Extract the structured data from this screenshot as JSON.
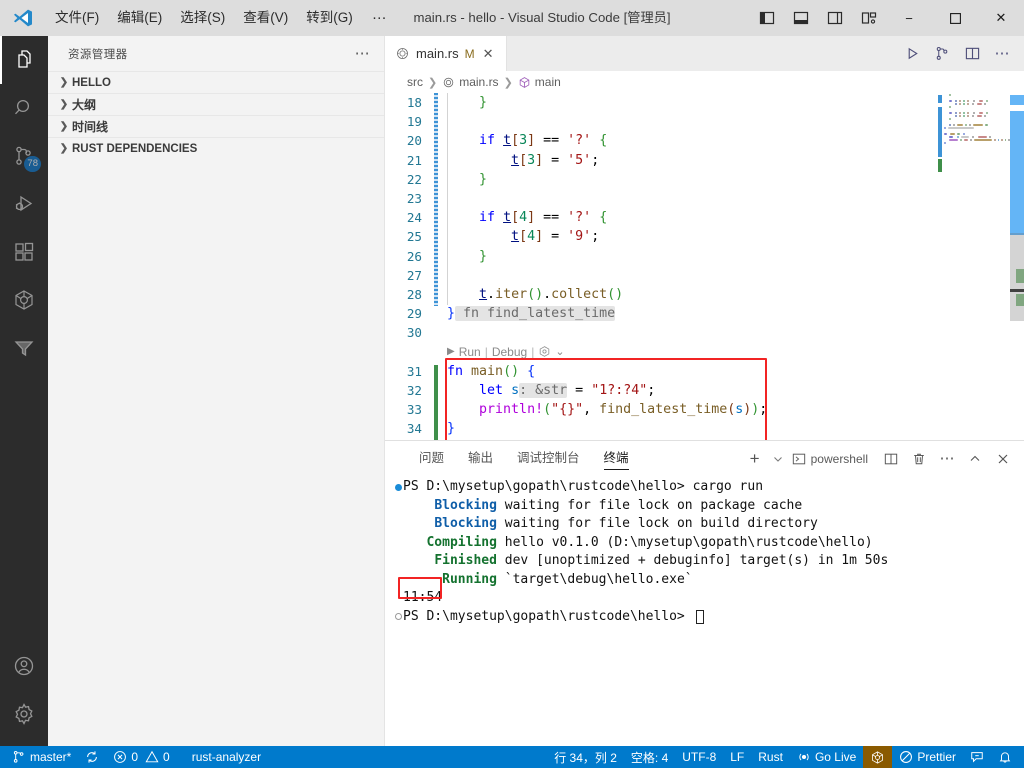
{
  "titlebar": {
    "logo_icon": "vscode-logo-icon",
    "menus": [
      {
        "label": "文件(F)",
        "name": "menu-file"
      },
      {
        "label": "编辑(E)",
        "name": "menu-edit"
      },
      {
        "label": "选择(S)",
        "name": "menu-selection"
      },
      {
        "label": "查看(V)",
        "name": "menu-view"
      },
      {
        "label": "转到(G)",
        "name": "menu-goto"
      }
    ],
    "more_label": "…",
    "title": "main.rs - hello - Visual Studio Code [管理员]",
    "layout_controls": [
      {
        "name": "toggle-primary-sidebar-icon"
      },
      {
        "name": "toggle-panel-icon"
      },
      {
        "name": "toggle-secondary-sidebar-icon"
      },
      {
        "name": "customize-layout-icon"
      }
    ],
    "window_controls": {
      "minimize": "−",
      "maximize": "▢",
      "close": "✕"
    }
  },
  "activitybar": {
    "items": [
      {
        "name": "activity-explorer",
        "icon": "files-icon",
        "active": true,
        "badge": ""
      },
      {
        "name": "activity-search",
        "icon": "search-icon",
        "active": false,
        "badge": ""
      },
      {
        "name": "activity-source-control",
        "icon": "source-control-icon",
        "active": false,
        "badge": "78"
      },
      {
        "name": "activity-run-debug",
        "icon": "run-and-debug-icon",
        "active": false,
        "badge": ""
      },
      {
        "name": "activity-extensions",
        "icon": "extensions-icon",
        "active": false,
        "badge": ""
      },
      {
        "name": "activity-rust-analyzer",
        "icon": "rust-analyzer-icon",
        "active": false,
        "badge": ""
      },
      {
        "name": "activity-todo-tree",
        "icon": "funnel-icon",
        "active": false,
        "badge": ""
      }
    ],
    "bottom": [
      {
        "name": "activity-accounts",
        "icon": "account-icon"
      },
      {
        "name": "activity-settings",
        "icon": "gear-icon"
      }
    ]
  },
  "sidebar": {
    "title": "资源管理器",
    "more_icon": "ellipsis-icon",
    "sections": [
      {
        "label": "HELLO",
        "expanded": false,
        "cn": false
      },
      {
        "label": "大纲",
        "expanded": false,
        "cn": true
      },
      {
        "label": "时间线",
        "expanded": false,
        "cn": true
      },
      {
        "label": "RUST DEPENDENCIES",
        "expanded": false,
        "cn": false
      }
    ]
  },
  "editor": {
    "tab": {
      "filename": "main.rs",
      "modified_badge": "M",
      "close_icon": "close-icon",
      "file_icon": "rust-file-icon"
    },
    "tab_actions": [
      {
        "name": "run-code-button",
        "icon": "play-icon"
      },
      {
        "name": "toggle-inlay-hints-button",
        "icon": "source-control-graph-icon"
      },
      {
        "name": "split-editor-right-button",
        "icon": "split-editor-icon"
      },
      {
        "name": "more-editor-actions-button",
        "icon": "ellipsis-icon"
      }
    ],
    "breadcrumbs": [
      {
        "label": "src",
        "icon": ""
      },
      {
        "label": "main.rs",
        "icon": "rust-file-icon"
      },
      {
        "label": "main",
        "icon": "symbol-method-icon"
      }
    ],
    "codelens": {
      "run": "Run",
      "debug": "Debug",
      "sep": "|",
      "play_icon": "play-small-icon",
      "rust_icon": "rust-analyzer-small-icon",
      "chevron": "⌄"
    },
    "lines": [
      {
        "n": "18",
        "tokens": [
          {
            "t": "    ",
            "c": "plain"
          },
          {
            "t": "}",
            "c": "brc2"
          }
        ]
      },
      {
        "n": "19",
        "tokens": []
      },
      {
        "n": "20",
        "tokens": [
          {
            "t": "    ",
            "c": "plain"
          },
          {
            "t": "if",
            "c": "kw"
          },
          {
            "t": " ",
            "c": "plain"
          },
          {
            "t": "t",
            "c": "varU"
          },
          {
            "t": "[",
            "c": "brc3"
          },
          {
            "t": "3",
            "c": "num"
          },
          {
            "t": "]",
            "c": "brc3"
          },
          {
            "t": " ",
            "c": "plain"
          },
          {
            "t": "==",
            "c": "punc"
          },
          {
            "t": " ",
            "c": "plain"
          },
          {
            "t": "'?'",
            "c": "str"
          },
          {
            "t": " ",
            "c": "plain"
          },
          {
            "t": "{",
            "c": "brc2"
          }
        ]
      },
      {
        "n": "21",
        "tokens": [
          {
            "t": "        ",
            "c": "plain"
          },
          {
            "t": "t",
            "c": "varU"
          },
          {
            "t": "[",
            "c": "brc3"
          },
          {
            "t": "3",
            "c": "num"
          },
          {
            "t": "]",
            "c": "brc3"
          },
          {
            "t": " ",
            "c": "plain"
          },
          {
            "t": "=",
            "c": "punc"
          },
          {
            "t": " ",
            "c": "plain"
          },
          {
            "t": "'5'",
            "c": "str"
          },
          {
            "t": ";",
            "c": "punc"
          }
        ]
      },
      {
        "n": "22",
        "tokens": [
          {
            "t": "    ",
            "c": "plain"
          },
          {
            "t": "}",
            "c": "brc2"
          }
        ]
      },
      {
        "n": "23",
        "tokens": []
      },
      {
        "n": "24",
        "tokens": [
          {
            "t": "    ",
            "c": "plain"
          },
          {
            "t": "if",
            "c": "kw"
          },
          {
            "t": " ",
            "c": "plain"
          },
          {
            "t": "t",
            "c": "varU"
          },
          {
            "t": "[",
            "c": "brc3"
          },
          {
            "t": "4",
            "c": "num"
          },
          {
            "t": "]",
            "c": "brc3"
          },
          {
            "t": " ",
            "c": "plain"
          },
          {
            "t": "==",
            "c": "punc"
          },
          {
            "t": " ",
            "c": "plain"
          },
          {
            "t": "'?'",
            "c": "str"
          },
          {
            "t": " ",
            "c": "plain"
          },
          {
            "t": "{",
            "c": "brc2"
          }
        ]
      },
      {
        "n": "25",
        "tokens": [
          {
            "t": "        ",
            "c": "plain"
          },
          {
            "t": "t",
            "c": "varU"
          },
          {
            "t": "[",
            "c": "brc3"
          },
          {
            "t": "4",
            "c": "num"
          },
          {
            "t": "]",
            "c": "brc3"
          },
          {
            "t": " ",
            "c": "plain"
          },
          {
            "t": "=",
            "c": "punc"
          },
          {
            "t": " ",
            "c": "plain"
          },
          {
            "t": "'9'",
            "c": "str"
          },
          {
            "t": ";",
            "c": "punc"
          }
        ]
      },
      {
        "n": "26",
        "tokens": [
          {
            "t": "    ",
            "c": "plain"
          },
          {
            "t": "}",
            "c": "brc2"
          }
        ]
      },
      {
        "n": "27",
        "tokens": []
      },
      {
        "n": "28",
        "tokens": [
          {
            "t": "    ",
            "c": "plain"
          },
          {
            "t": "t",
            "c": "varU"
          },
          {
            "t": ".",
            "c": "punc"
          },
          {
            "t": "iter",
            "c": "fnname"
          },
          {
            "t": "()",
            "c": "brc2"
          },
          {
            "t": ".",
            "c": "punc"
          },
          {
            "t": "collect",
            "c": "fnname"
          },
          {
            "t": "()",
            "c": "brc2"
          }
        ]
      },
      {
        "n": "29",
        "tokens": [
          {
            "t": "}",
            "c": "brc1"
          },
          {
            "t": " fn find_latest_time",
            "c": "inlay"
          }
        ]
      },
      {
        "n": "30",
        "tokens": []
      },
      {
        "n": "31",
        "tokens": [
          {
            "t": "fn",
            "c": "kw"
          },
          {
            "t": " ",
            "c": "plain"
          },
          {
            "t": "main",
            "c": "fnname"
          },
          {
            "t": "()",
            "c": "brc2"
          },
          {
            "t": " ",
            "c": "plain"
          },
          {
            "t": "{",
            "c": "brc1"
          }
        ]
      },
      {
        "n": "32",
        "tokens": [
          {
            "t": "    ",
            "c": "plain"
          },
          {
            "t": "let",
            "c": "kw"
          },
          {
            "t": " ",
            "c": "plain"
          },
          {
            "t": "s",
            "c": "var"
          },
          {
            "t": ": &str",
            "c": "inlay"
          },
          {
            "t": " ",
            "c": "plain"
          },
          {
            "t": "=",
            "c": "punc"
          },
          {
            "t": " ",
            "c": "plain"
          },
          {
            "t": "\"1?:?4\"",
            "c": "str"
          },
          {
            "t": ";",
            "c": "punc"
          }
        ]
      },
      {
        "n": "33",
        "tokens": [
          {
            "t": "    ",
            "c": "plain"
          },
          {
            "t": "println!",
            "c": "kw2"
          },
          {
            "t": "(",
            "c": "brc2"
          },
          {
            "t": "\"{}\"",
            "c": "str"
          },
          {
            "t": ", ",
            "c": "punc"
          },
          {
            "t": "find_latest_time",
            "c": "fnname"
          },
          {
            "t": "(",
            "c": "brc3"
          },
          {
            "t": "s",
            "c": "var"
          },
          {
            "t": ")",
            "c": "brc3"
          },
          {
            "t": ")",
            "c": "brc2"
          },
          {
            "t": ";",
            "c": "punc"
          }
        ]
      },
      {
        "n": "34",
        "tokens": [
          {
            "t": "}",
            "c": "brc1"
          }
        ]
      }
    ]
  },
  "panel": {
    "tabs": [
      {
        "label": "问题",
        "active": false,
        "name": "panel-tab-problems"
      },
      {
        "label": "输出",
        "active": false,
        "name": "panel-tab-output"
      },
      {
        "label": "调试控制台",
        "active": false,
        "name": "panel-tab-debug-console"
      },
      {
        "label": "终端",
        "active": true,
        "name": "panel-tab-terminal"
      }
    ],
    "actions": {
      "new_terminal_icon": "plus-icon",
      "new_terminal_dropdown_icon": "chevron-down-icon",
      "shell_icon": "terminal-powershell-icon",
      "shell_name": "powershell",
      "split_icon": "split-terminal-icon",
      "kill_icon": "trash-icon",
      "more_icon": "ellipsis-icon",
      "maximize_icon": "chevron-up-icon",
      "close_icon": "close-icon"
    },
    "terminal_lines": [
      {
        "marker": "filled",
        "segs": [
          {
            "t": "PS D:\\mysetup\\gopath\\rustcode\\hello> cargo run",
            "c": "t-plain"
          }
        ]
      },
      {
        "marker": "none",
        "segs": [
          {
            "t": "    ",
            "c": "t-plain"
          },
          {
            "t": "Blocking",
            "c": "t-blue"
          },
          {
            "t": " waiting for file lock on package cache",
            "c": "t-plain"
          }
        ]
      },
      {
        "marker": "none",
        "segs": [
          {
            "t": "    ",
            "c": "t-plain"
          },
          {
            "t": "Blocking",
            "c": "t-blue"
          },
          {
            "t": " waiting for file lock on build directory",
            "c": "t-plain"
          }
        ]
      },
      {
        "marker": "none",
        "segs": [
          {
            "t": "   ",
            "c": "t-plain"
          },
          {
            "t": "Compiling",
            "c": "t-green"
          },
          {
            "t": " hello v0.1.0 (D:\\mysetup\\gopath\\rustcode\\hello)",
            "c": "t-plain"
          }
        ]
      },
      {
        "marker": "none",
        "segs": [
          {
            "t": "    ",
            "c": "t-plain"
          },
          {
            "t": "Finished",
            "c": "t-green"
          },
          {
            "t": " dev [unoptimized + debuginfo] target(s) in 1m 50s",
            "c": "t-plain"
          }
        ]
      },
      {
        "marker": "none",
        "segs": [
          {
            "t": "     ",
            "c": "t-plain"
          },
          {
            "t": "Running",
            "c": "t-green"
          },
          {
            "t": " `target\\debug\\hello.exe`",
            "c": "t-plain"
          }
        ]
      },
      {
        "marker": "none",
        "segs": [
          {
            "t": "11:54",
            "c": "t-plain"
          }
        ]
      },
      {
        "marker": "hollow",
        "segs": [
          {
            "t": "PS D:\\mysetup\\gopath\\rustcode\\hello> ",
            "c": "t-plain"
          }
        ]
      }
    ]
  },
  "statusbar": {
    "left": [
      {
        "name": "status-branch",
        "icon": "source-control-icon",
        "label": "master*"
      },
      {
        "name": "status-sync",
        "icon": "sync-icon",
        "label": ""
      },
      {
        "name": "status-problems",
        "icon": "error-warning-icon",
        "label": "0  0",
        "error": "0",
        "warning": "0"
      },
      {
        "name": "status-rust-analyzer",
        "icon": "",
        "label": "rust-analyzer"
      }
    ],
    "right": [
      {
        "name": "status-cursor-position",
        "label": "行 34，列 2"
      },
      {
        "name": "status-indentation",
        "label": "空格: 4"
      },
      {
        "name": "status-encoding",
        "label": "UTF-8"
      },
      {
        "name": "status-eol",
        "label": "LF"
      },
      {
        "name": "status-language-mode",
        "label": "Rust"
      },
      {
        "name": "status-go-live",
        "icon": "broadcast-icon",
        "label": "Go Live"
      },
      {
        "name": "status-rust-icon",
        "icon": "rust-analyzer-icon",
        "label": "",
        "highlight": true
      },
      {
        "name": "status-prettier",
        "icon": "prettier-icon",
        "label": "Prettier"
      },
      {
        "name": "status-feedback",
        "icon": "feedback-icon",
        "label": ""
      },
      {
        "name": "status-notifications",
        "icon": "bell-icon",
        "label": ""
      }
    ]
  },
  "colors": {
    "accent": "#007acc",
    "titlebar_bg": "#dddddd",
    "activitybar_bg": "#2c2c2c",
    "sidebar_bg": "#f3f3f3",
    "annotation_red": "#f22424",
    "badge_blue": "#0e7ad1"
  }
}
